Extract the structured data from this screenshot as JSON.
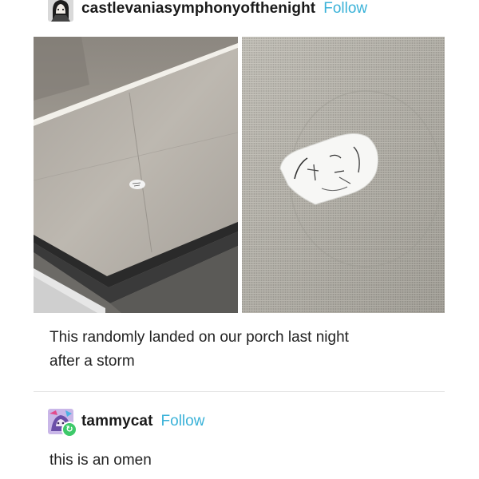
{
  "post": {
    "author": "castlevaniasymphonyofthenight",
    "follow_label": "Follow",
    "caption_line1": "This randomly landed on our porch last night",
    "caption_line2": "after a storm"
  },
  "reply": {
    "author": "tammycat",
    "follow_label": "Follow",
    "text": "this is an omen"
  },
  "colors": {
    "follow": "#3ab2d8",
    "reblog_badge": "#3ec96a"
  },
  "icons": [
    "author-avatar",
    "reblog-icon"
  ]
}
